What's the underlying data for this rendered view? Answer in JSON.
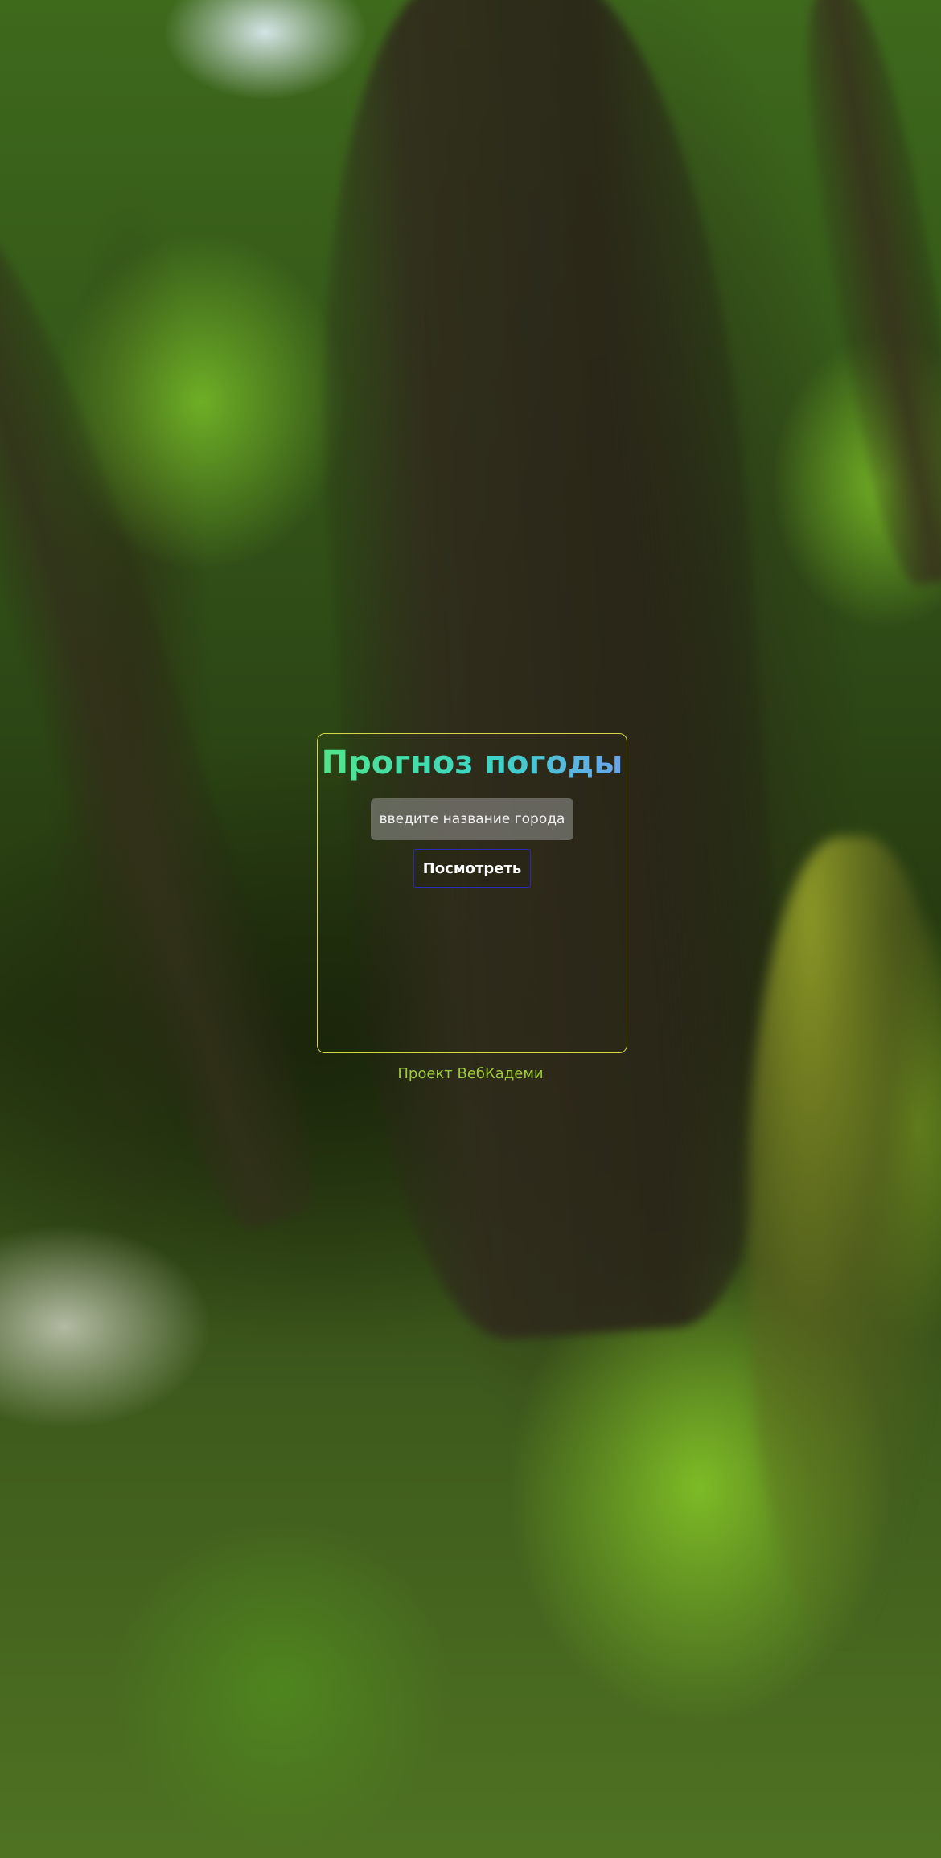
{
  "app": {
    "title": "Прогноз погоды"
  },
  "search": {
    "placeholder": "введите название города",
    "value": "",
    "button_label": "Посмотреть"
  },
  "footer": {
    "link_text": "Проект ВебКадеми"
  },
  "colors": {
    "card_border": "#d7d64a",
    "title_gradient_start": "#4fe68a",
    "title_gradient_end": "#6aa2f0",
    "button_border": "#2a2ab8",
    "footer_link": "#9ecb3a"
  }
}
